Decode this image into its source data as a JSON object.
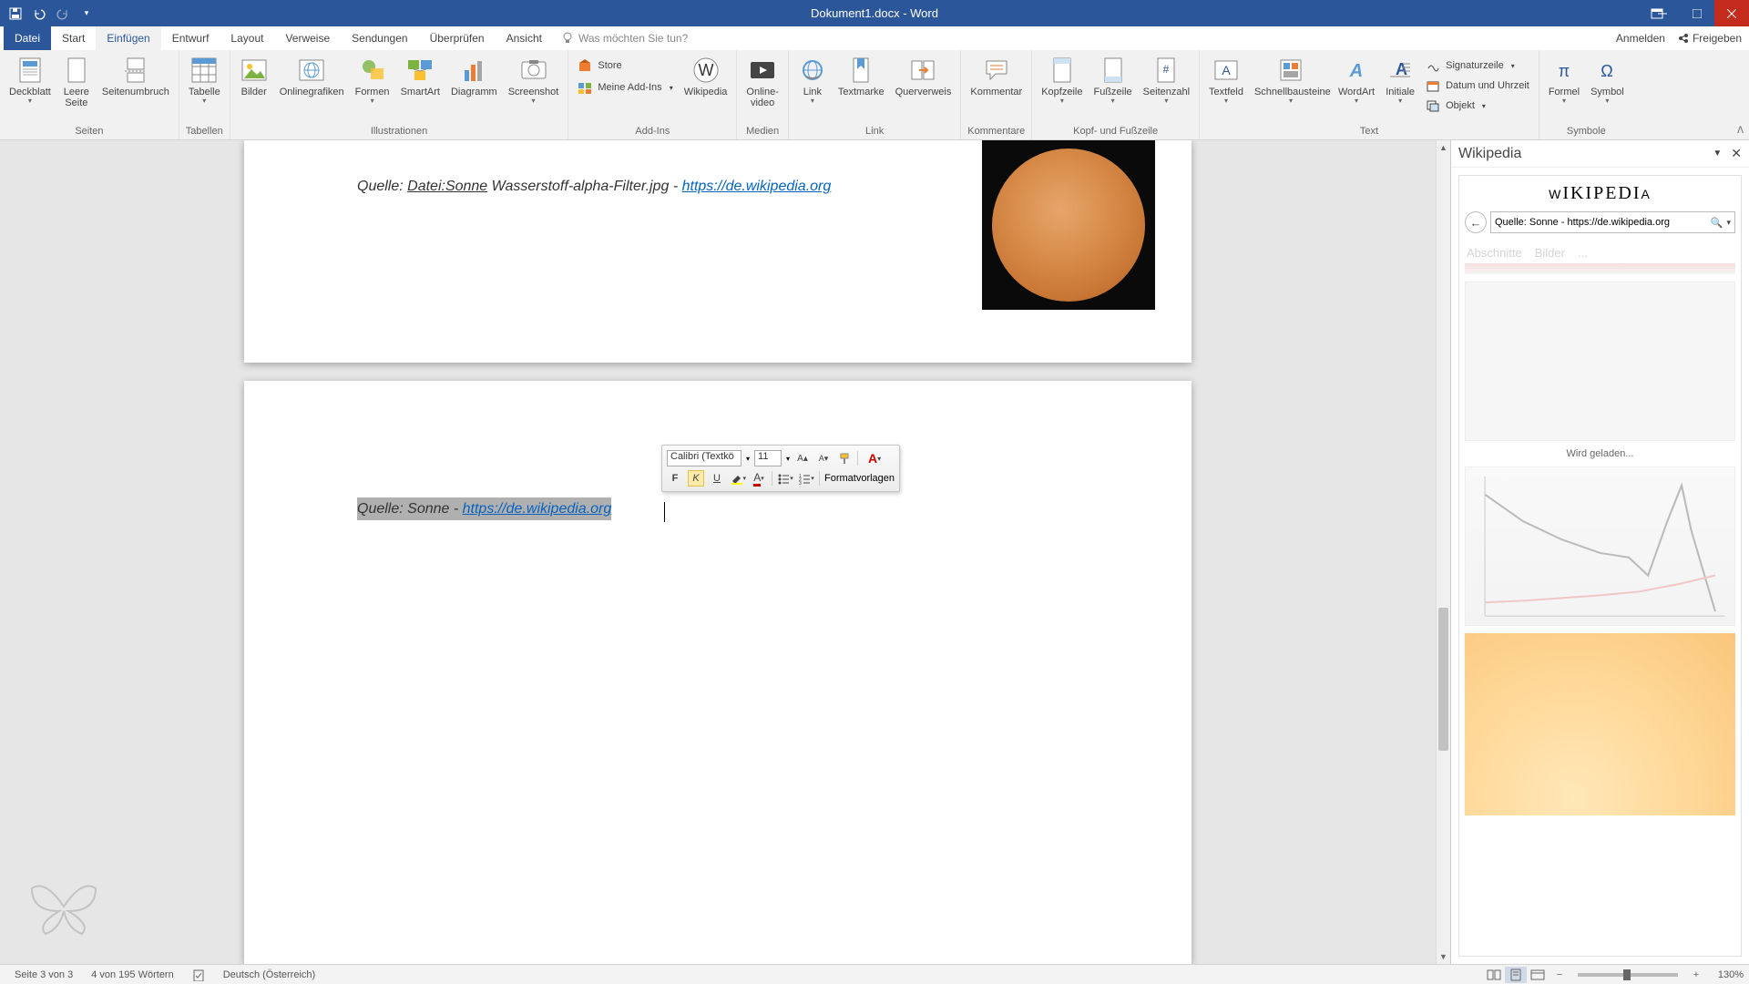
{
  "titleBar": {
    "title": "Dokument1.docx - Word"
  },
  "tabs": {
    "file": "Datei",
    "items": [
      "Start",
      "Einfügen",
      "Entwurf",
      "Layout",
      "Verweise",
      "Sendungen",
      "Überprüfen",
      "Ansicht"
    ],
    "activeIndex": 1,
    "tellMe": "Was möchten Sie tun?",
    "rightLinks": {
      "signIn": "Anmelden",
      "share": "Freigeben"
    }
  },
  "ribbon": {
    "groups": {
      "seiten": {
        "label": "Seiten",
        "deckblatt": "Deckblatt",
        "leereSeite": "Leere\nSeite",
        "seitenumbruch": "Seitenumbruch"
      },
      "tabellen": {
        "label": "Tabellen",
        "tabelle": "Tabelle"
      },
      "illustrationen": {
        "label": "Illustrationen",
        "bilder": "Bilder",
        "onlinegrafiken": "Onlinegrafiken",
        "formen": "Formen",
        "smartart": "SmartArt",
        "diagramm": "Diagramm",
        "screenshot": "Screenshot"
      },
      "addins": {
        "label": "Add-Ins",
        "store": "Store",
        "meineAddins": "Meine Add-Ins",
        "wikipedia": "Wikipedia"
      },
      "medien": {
        "label": "Medien",
        "onlinevideo": "Online-\nvideo"
      },
      "link": {
        "label": "Link",
        "link": "Link",
        "textmarke": "Textmarke",
        "querverweis": "Querverweis"
      },
      "kommentare": {
        "label": "Kommentare",
        "kommentar": "Kommentar"
      },
      "kopfFuss": {
        "label": "Kopf- und Fußzeile",
        "kopfzeile": "Kopfzeile",
        "fusszeile": "Fußzeile",
        "seitenzahl": "Seitenzahl"
      },
      "text": {
        "label": "Text",
        "textfeld": "Textfeld",
        "schnellbausteine": "Schnellbausteine",
        "wordart": "WordArt",
        "initiale": "Initiale",
        "signaturzeile": "Signaturzeile",
        "datumUhrzeit": "Datum und Uhrzeit",
        "objekt": "Objekt"
      },
      "symbole": {
        "label": "Symbole",
        "formel": "Formel",
        "symbol": "Symbol"
      }
    }
  },
  "document": {
    "caption1_prefix": "Quelle: ",
    "caption1_file": "Datei:Sonne",
    "caption1_mid": " Wasserstoff-alpha-Filter.jpg - ",
    "caption1_link": "https://de.wikipedia.org",
    "caption2_text": "Quelle: Sonne - ",
    "caption2_link": "https://de.wikipedia.org"
  },
  "miniToolbar": {
    "fontName": "Calibri (Textkö",
    "fontSize": "11",
    "formatvorlagen": "Formatvorlagen",
    "bold": "F",
    "italic": "K",
    "underline": "U"
  },
  "wikiPane": {
    "title": "Wikipedia",
    "logo": "WIKIPEDIA",
    "searchValue": "Quelle: Sonne - https://de.wikipedia.org",
    "tab1": "Abschnitte",
    "tab2": "Bilder",
    "tabMore": "...",
    "loading": "Wird geladen..."
  },
  "statusBar": {
    "page": "Seite 3 von 3",
    "words": "4 von 195 Wörtern",
    "language": "Deutsch (Österreich)",
    "zoom": "130%"
  }
}
